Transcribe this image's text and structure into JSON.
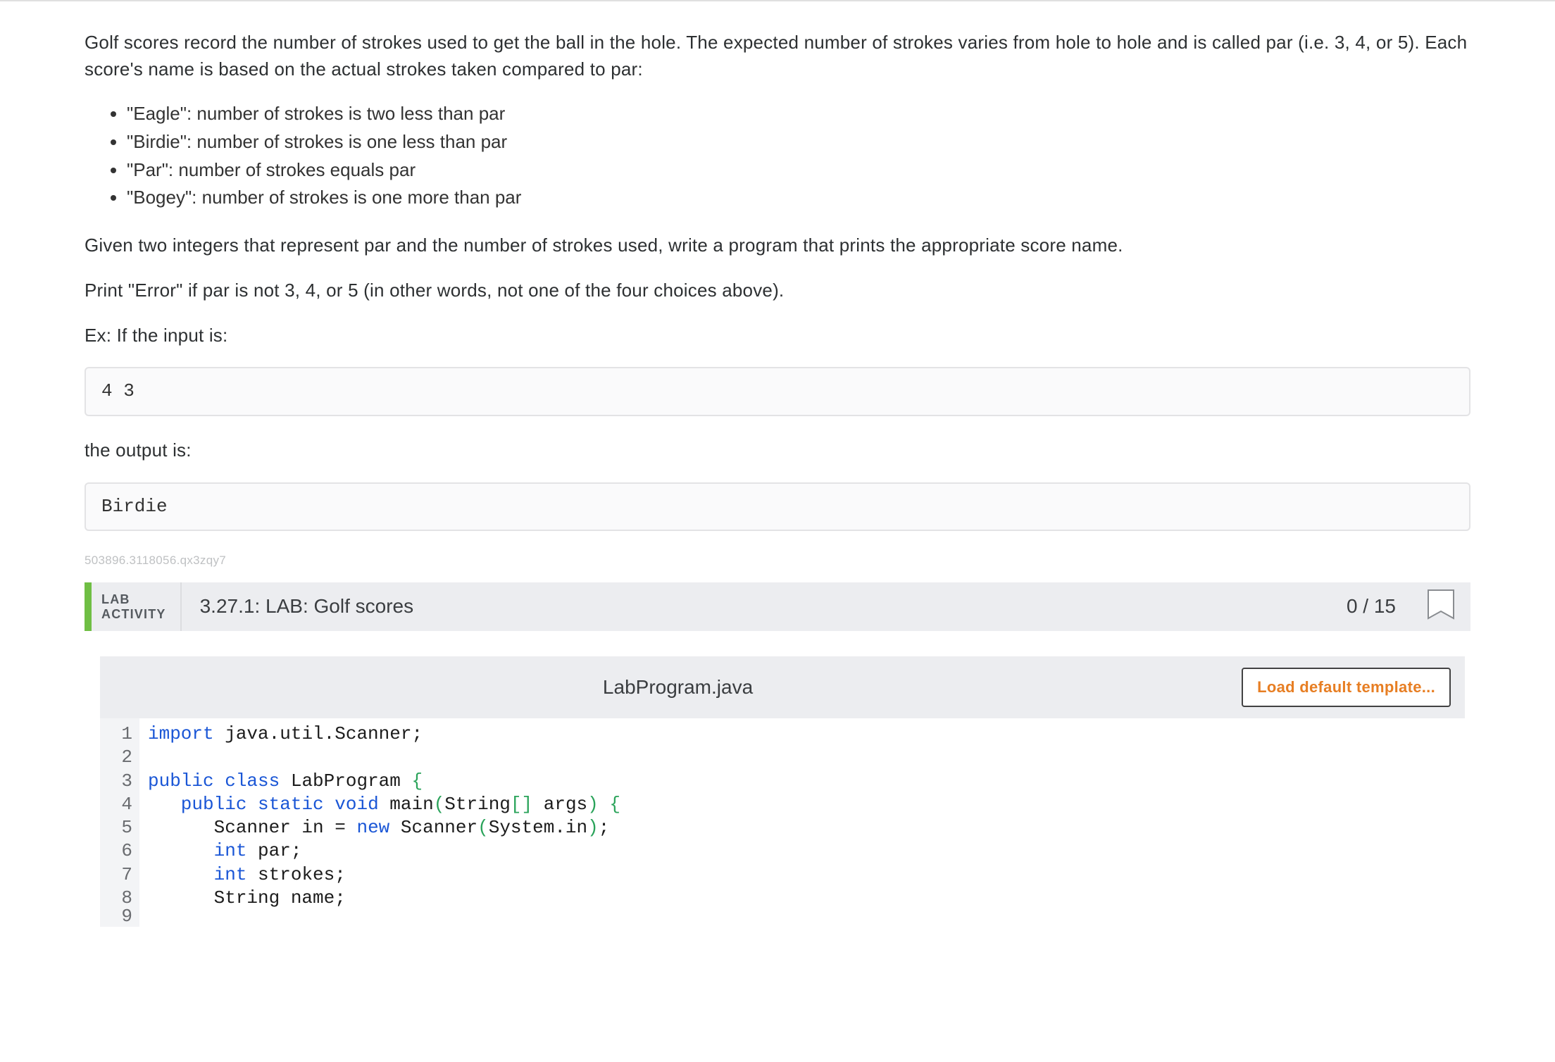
{
  "intro": {
    "p1": "Golf scores record the number of strokes used to get the ball in the hole. The expected number of strokes varies from hole to hole and is called par (i.e. 3, 4, or 5). Each score's name is based on the actual strokes taken compared to par:",
    "bullets": [
      "\"Eagle\": number of strokes is two less than par",
      "\"Birdie\": number of strokes is one less than par",
      "\"Par\": number of strokes equals par",
      "\"Bogey\": number of strokes is one more than par"
    ],
    "p2": "Given two integers that represent par and the number of strokes used, write a program that prints the appropriate score name.",
    "p3": "Print \"Error\" if par is not 3, 4, or 5 (in other words, not one of the four choices above).",
    "p4": "Ex: If the input is:",
    "input_example": "4 3",
    "p5": "the output is:",
    "output_example": "Birdie"
  },
  "refcode": "503896.3118056.qx3zqy7",
  "lab": {
    "badge_l1": "LAB",
    "badge_l2": "ACTIVITY",
    "title": "3.27.1: LAB: Golf scores",
    "score": "0 / 15"
  },
  "editor": {
    "filename": "LabProgram.java",
    "template_btn": "Load default template...",
    "gutter": [
      "1",
      "2",
      "3",
      "4",
      "5",
      "6",
      "7",
      "8",
      "9"
    ],
    "code": {
      "l1_a": "import",
      "l1_b": " java.util.Scanner;",
      "l2": "",
      "l3_a": "public",
      "l3_b": " class",
      "l3_c": " LabProgram ",
      "l3_d": "{",
      "l4_a": "   public",
      "l4_b": " static",
      "l4_c": " void",
      "l4_d": " main",
      "l4_e": "(",
      "l4_f": "String",
      "l4_g": "[]",
      "l4_h": " args",
      "l4_i": ")",
      "l4_j": " {",
      "l5_a": "      Scanner in ",
      "l5_b": "=",
      "l5_c": " new",
      "l5_d": " Scanner",
      "l5_e": "(",
      "l5_f": "System.in",
      "l5_g": ")",
      "l5_h": ";",
      "l6_a": "      int",
      "l6_b": " par;",
      "l7_a": "      int",
      "l7_b": " strokes;",
      "l8_a": "      String name;",
      "l9": ""
    }
  }
}
